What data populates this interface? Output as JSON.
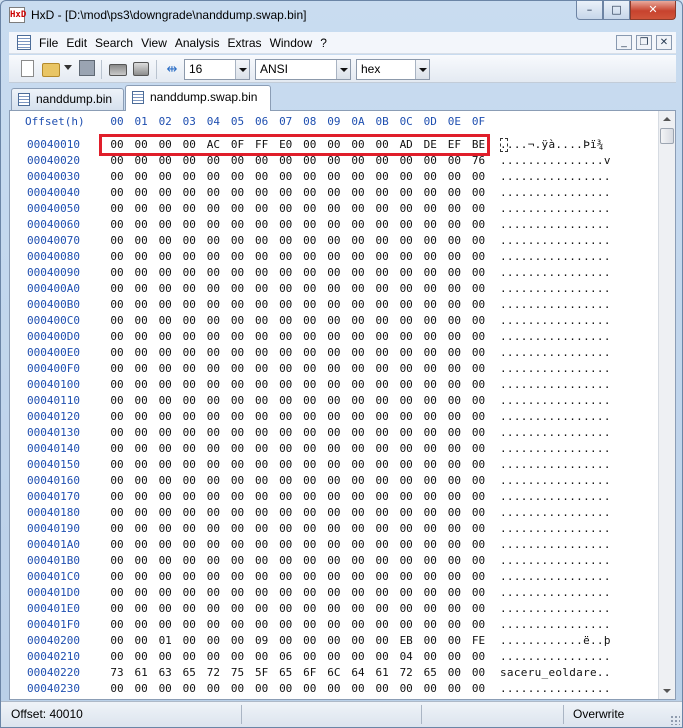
{
  "window": {
    "title": "HxD - [D:\\mod\\ps3\\downgrade\\nanddump.swap.bin]",
    "minimize": "–",
    "maximize": "□",
    "close": "✕"
  },
  "menu": {
    "items": [
      "File",
      "Edit",
      "Search",
      "View",
      "Analysis",
      "Extras",
      "Window",
      "?"
    ],
    "mdi_minimize": "_",
    "mdi_restore": "❐",
    "mdi_close": "✕"
  },
  "toolbar": {
    "bytes_per_row": "16",
    "charset": "ANSI",
    "offset_base": "hex",
    "icons": [
      "new-file-icon",
      "open-file-icon",
      "save-icon",
      "ram-icon",
      "disk-icon",
      "columns-icon"
    ]
  },
  "tabs": [
    {
      "label": "nanddump.bin",
      "active": false
    },
    {
      "label": "nanddump.swap.bin",
      "active": true
    }
  ],
  "hex": {
    "offset_header": "Offset(h)",
    "columns": [
      "00",
      "01",
      "02",
      "03",
      "04",
      "05",
      "06",
      "07",
      "08",
      "09",
      "0A",
      "0B",
      "0C",
      "0D",
      "0E",
      "0F"
    ],
    "highlight_color": "#e01e2a",
    "rows": [
      {
        "offset": "00040010",
        "bytes": "00 00 00 00 AC 0F FF E0 00 00 00 00 AD DE EF BE",
        "ascii": "....¬.ÿà....Þï¾"
      },
      {
        "offset": "00040020",
        "bytes": "00 00 00 00 00 00 00 00 00 00 00 00 00 00 00 76",
        "ascii": "...............v"
      },
      {
        "offset": "00040030",
        "bytes": "00 00 00 00 00 00 00 00 00 00 00 00 00 00 00 00",
        "ascii": "................"
      },
      {
        "offset": "00040040",
        "bytes": "00 00 00 00 00 00 00 00 00 00 00 00 00 00 00 00",
        "ascii": "................"
      },
      {
        "offset": "00040050",
        "bytes": "00 00 00 00 00 00 00 00 00 00 00 00 00 00 00 00",
        "ascii": "................"
      },
      {
        "offset": "00040060",
        "bytes": "00 00 00 00 00 00 00 00 00 00 00 00 00 00 00 00",
        "ascii": "................"
      },
      {
        "offset": "00040070",
        "bytes": "00 00 00 00 00 00 00 00 00 00 00 00 00 00 00 00",
        "ascii": "................"
      },
      {
        "offset": "00040080",
        "bytes": "00 00 00 00 00 00 00 00 00 00 00 00 00 00 00 00",
        "ascii": "................"
      },
      {
        "offset": "00040090",
        "bytes": "00 00 00 00 00 00 00 00 00 00 00 00 00 00 00 00",
        "ascii": "................"
      },
      {
        "offset": "000400A0",
        "bytes": "00 00 00 00 00 00 00 00 00 00 00 00 00 00 00 00",
        "ascii": "................"
      },
      {
        "offset": "000400B0",
        "bytes": "00 00 00 00 00 00 00 00 00 00 00 00 00 00 00 00",
        "ascii": "................"
      },
      {
        "offset": "000400C0",
        "bytes": "00 00 00 00 00 00 00 00 00 00 00 00 00 00 00 00",
        "ascii": "................"
      },
      {
        "offset": "000400D0",
        "bytes": "00 00 00 00 00 00 00 00 00 00 00 00 00 00 00 00",
        "ascii": "................"
      },
      {
        "offset": "000400E0",
        "bytes": "00 00 00 00 00 00 00 00 00 00 00 00 00 00 00 00",
        "ascii": "................"
      },
      {
        "offset": "000400F0",
        "bytes": "00 00 00 00 00 00 00 00 00 00 00 00 00 00 00 00",
        "ascii": "................"
      },
      {
        "offset": "00040100",
        "bytes": "00 00 00 00 00 00 00 00 00 00 00 00 00 00 00 00",
        "ascii": "................"
      },
      {
        "offset": "00040110",
        "bytes": "00 00 00 00 00 00 00 00 00 00 00 00 00 00 00 00",
        "ascii": "................"
      },
      {
        "offset": "00040120",
        "bytes": "00 00 00 00 00 00 00 00 00 00 00 00 00 00 00 00",
        "ascii": "................"
      },
      {
        "offset": "00040130",
        "bytes": "00 00 00 00 00 00 00 00 00 00 00 00 00 00 00 00",
        "ascii": "................"
      },
      {
        "offset": "00040140",
        "bytes": "00 00 00 00 00 00 00 00 00 00 00 00 00 00 00 00",
        "ascii": "................"
      },
      {
        "offset": "00040150",
        "bytes": "00 00 00 00 00 00 00 00 00 00 00 00 00 00 00 00",
        "ascii": "................"
      },
      {
        "offset": "00040160",
        "bytes": "00 00 00 00 00 00 00 00 00 00 00 00 00 00 00 00",
        "ascii": "................"
      },
      {
        "offset": "00040170",
        "bytes": "00 00 00 00 00 00 00 00 00 00 00 00 00 00 00 00",
        "ascii": "................"
      },
      {
        "offset": "00040180",
        "bytes": "00 00 00 00 00 00 00 00 00 00 00 00 00 00 00 00",
        "ascii": "................"
      },
      {
        "offset": "00040190",
        "bytes": "00 00 00 00 00 00 00 00 00 00 00 00 00 00 00 00",
        "ascii": "................"
      },
      {
        "offset": "000401A0",
        "bytes": "00 00 00 00 00 00 00 00 00 00 00 00 00 00 00 00",
        "ascii": "................"
      },
      {
        "offset": "000401B0",
        "bytes": "00 00 00 00 00 00 00 00 00 00 00 00 00 00 00 00",
        "ascii": "................"
      },
      {
        "offset": "000401C0",
        "bytes": "00 00 00 00 00 00 00 00 00 00 00 00 00 00 00 00",
        "ascii": "................"
      },
      {
        "offset": "000401D0",
        "bytes": "00 00 00 00 00 00 00 00 00 00 00 00 00 00 00 00",
        "ascii": "................"
      },
      {
        "offset": "000401E0",
        "bytes": "00 00 00 00 00 00 00 00 00 00 00 00 00 00 00 00",
        "ascii": "................"
      },
      {
        "offset": "000401F0",
        "bytes": "00 00 00 00 00 00 00 00 00 00 00 00 00 00 00 00",
        "ascii": "................"
      },
      {
        "offset": "00040200",
        "bytes": "00 00 01 00 00 00 09 00 00 00 00 00 EB 00 00 FE",
        "ascii": "............ë..þ"
      },
      {
        "offset": "00040210",
        "bytes": "00 00 00 00 00 00 00 06 00 00 00 00 04 00 00 00",
        "ascii": "................"
      },
      {
        "offset": "00040220",
        "bytes": "73 61 63 65 72 75 5F 65 6F 6C 64 61 72 65 00 00",
        "ascii": "saceru_eoldare.."
      },
      {
        "offset": "00040230",
        "bytes": "00 00 00 00 00 00 00 00 00 00 00 00 00 00 00 00",
        "ascii": "................"
      }
    ]
  },
  "status": {
    "offset": "Offset: 40010",
    "mode": "Overwrite"
  }
}
